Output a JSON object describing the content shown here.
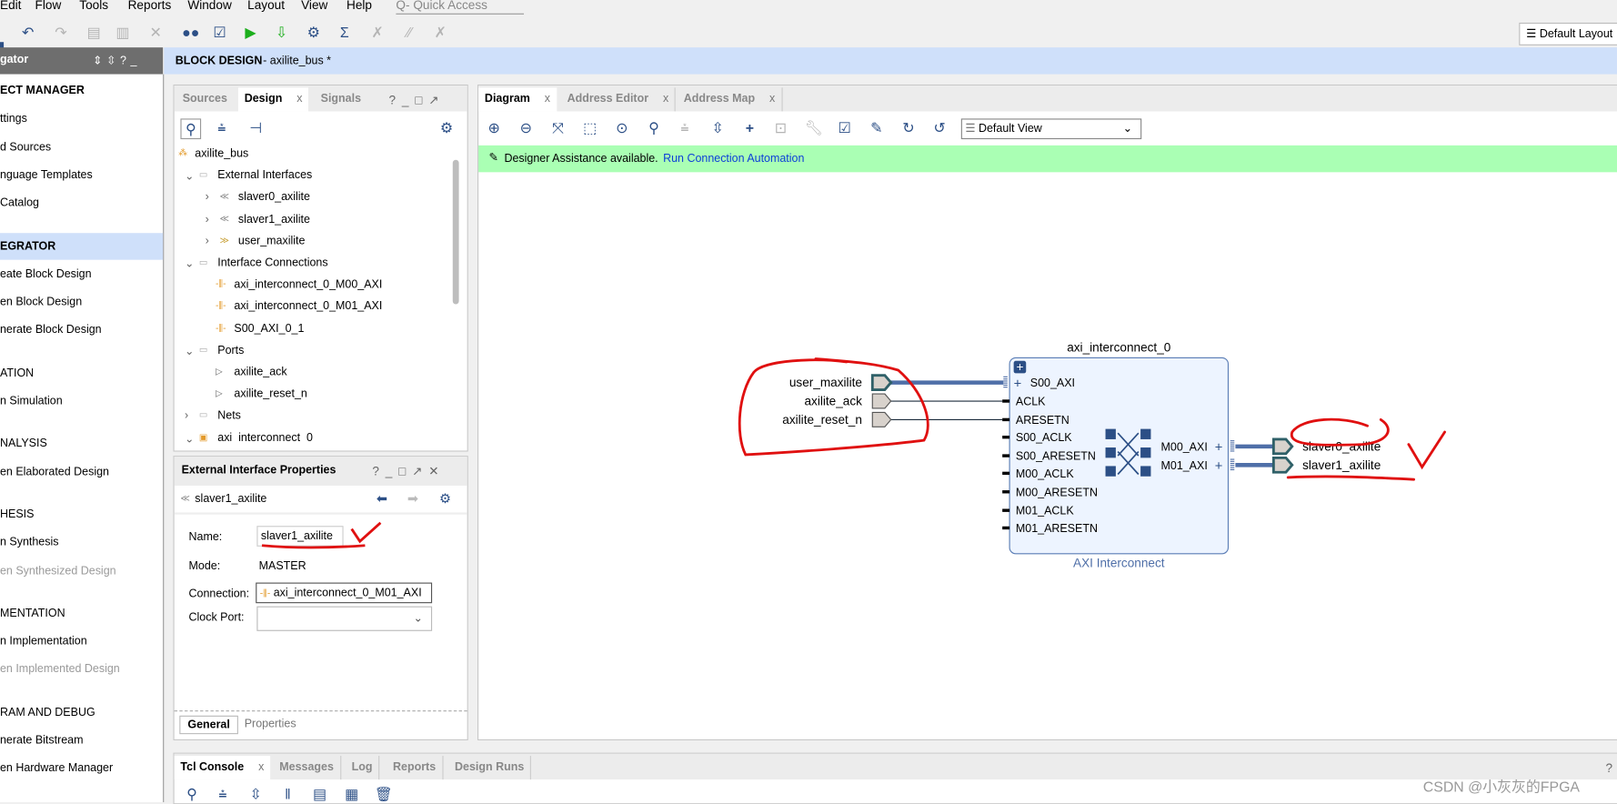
{
  "menu": [
    "Edit",
    "Flow",
    "Tools",
    "Reports",
    "Window",
    "Layout",
    "View",
    "Help"
  ],
  "quick_access": "Q- Quick Access",
  "default_layout": "Default Layout",
  "toolbar_icons": [
    "save-icon",
    "undo-icon",
    "redo-icon",
    "copy-icon",
    "paste-icon",
    "delete-icon",
    "find-icon",
    "check-icon",
    "run-icon",
    "program-icon",
    "settings-icon",
    "sigma-icon",
    "disabled-icon-1",
    "disabled-icon-2",
    "disabled-icon-3"
  ],
  "navigator": {
    "title": "gator",
    "items": [
      {
        "t": "ECT MANAGER",
        "k": "h"
      },
      {
        "t": "ttings"
      },
      {
        "t": "d Sources"
      },
      {
        "t": "nguage Templates"
      },
      {
        "t": "Catalog"
      },
      {
        "t": "EGRATOR",
        "k": "h"
      },
      {
        "t": "eate Block Design"
      },
      {
        "t": "en Block Design"
      },
      {
        "t": "nerate Block Design"
      },
      {
        "t": "ATION",
        "k": "s"
      },
      {
        "t": "n Simulation"
      },
      {
        "t": "NALYSIS",
        "k": "s"
      },
      {
        "t": "en Elaborated Design"
      },
      {
        "t": "HESIS",
        "k": "s"
      },
      {
        "t": "n Synthesis"
      },
      {
        "t": "en Synthesized Design",
        "k": "dis"
      },
      {
        "t": "MENTATION",
        "k": "s"
      },
      {
        "t": "n Implementation"
      },
      {
        "t": "en Implemented Design",
        "k": "dis"
      },
      {
        "t": "RAM AND DEBUG",
        "k": "s"
      },
      {
        "t": "nerate Bitstream"
      },
      {
        "t": "en Hardware Manager"
      }
    ]
  },
  "header": {
    "title": "BLOCK DESIGN",
    "subtitle": " - axilite_bus *"
  },
  "design_panel": {
    "tabs": [
      "Sources",
      "Design",
      "Signals"
    ],
    "close": "x",
    "tree": [
      {
        "t": "axilite_bus",
        "lvl": 0,
        "icon": "hierarchy-icon"
      },
      {
        "t": "External Interfaces",
        "lvl": 1,
        "icon": "folder-icon",
        "exp": "v"
      },
      {
        "t": "slaver0_axilite",
        "lvl": 2,
        "icon": "interface-in-icon",
        "exp": ">"
      },
      {
        "t": "slaver1_axilite",
        "lvl": 2,
        "icon": "interface-in-icon",
        "exp": ">"
      },
      {
        "t": "user_maxilite",
        "lvl": 2,
        "icon": "interface-out-icon",
        "exp": ">"
      },
      {
        "t": "Interface Connections",
        "lvl": 1,
        "icon": "folder-icon",
        "exp": "v"
      },
      {
        "t": "axi_interconnect_0_M00_AXI",
        "lvl": 3,
        "icon": "connection-icon"
      },
      {
        "t": "axi_interconnect_0_M01_AXI",
        "lvl": 3,
        "icon": "connection-icon"
      },
      {
        "t": "S00_AXI_0_1",
        "lvl": 3,
        "icon": "connection-icon"
      },
      {
        "t": "Ports",
        "lvl": 1,
        "icon": "folder-icon",
        "exp": "v"
      },
      {
        "t": "axilite_ack",
        "lvl": 3,
        "icon": "port-icon"
      },
      {
        "t": "axilite_reset_n",
        "lvl": 3,
        "icon": "port-icon"
      },
      {
        "t": "Nets",
        "lvl": 1,
        "icon": "folder-icon",
        "exp": ">"
      },
      {
        "t": "axi_interconnect_0",
        "lvl": 1,
        "icon": "ip-icon",
        "exp": "v"
      }
    ]
  },
  "properties": {
    "title": "External Interface Properties",
    "object": "slaver1_axilite",
    "name_label": "Name:",
    "name_value": "slaver1_axilite",
    "mode_label": "Mode:",
    "mode_value": "MASTER",
    "connection_label": "Connection:",
    "connection_value": "axi_interconnect_0_M01_AXI",
    "clock_label": "Clock Port:",
    "clock_value": "",
    "tabs": [
      "General",
      "Properties"
    ]
  },
  "diagram": {
    "tabs": [
      "Diagram",
      "Address Editor",
      "Address Map"
    ],
    "view_select": "Default View",
    "assist_text": "Designer Assistance available.",
    "assist_link": "Run Connection Automation",
    "block_name": "axi_interconnect_0",
    "block_type": "AXI Interconnect",
    "left_ports": [
      "user_maxilite",
      "axilite_ack",
      "axilite_reset_n"
    ],
    "right_ports": [
      "slaver0_axilite",
      "slaver1_axilite"
    ],
    "block_left_pins": [
      "S00_AXI",
      "ACLK",
      "ARESETN",
      "S00_ACLK",
      "S00_ARESETN",
      "M00_ACLK",
      "M00_ARESETN",
      "M01_ACLK",
      "M01_ARESETN"
    ],
    "block_right_pins": [
      "M00_AXI",
      "M01_AXI"
    ],
    "colors": {
      "bus": "#4f6fa8",
      "block_fill": "#edf4ff",
      "block_border": "#5a7db5",
      "annotation": "#e01010",
      "assist_bg": "#aaffb4"
    }
  },
  "console": {
    "tabs": [
      "Tcl Console",
      "Messages",
      "Log",
      "Reports",
      "Design Runs"
    ]
  },
  "watermark": "CSDN @小灰灰的FPGA"
}
